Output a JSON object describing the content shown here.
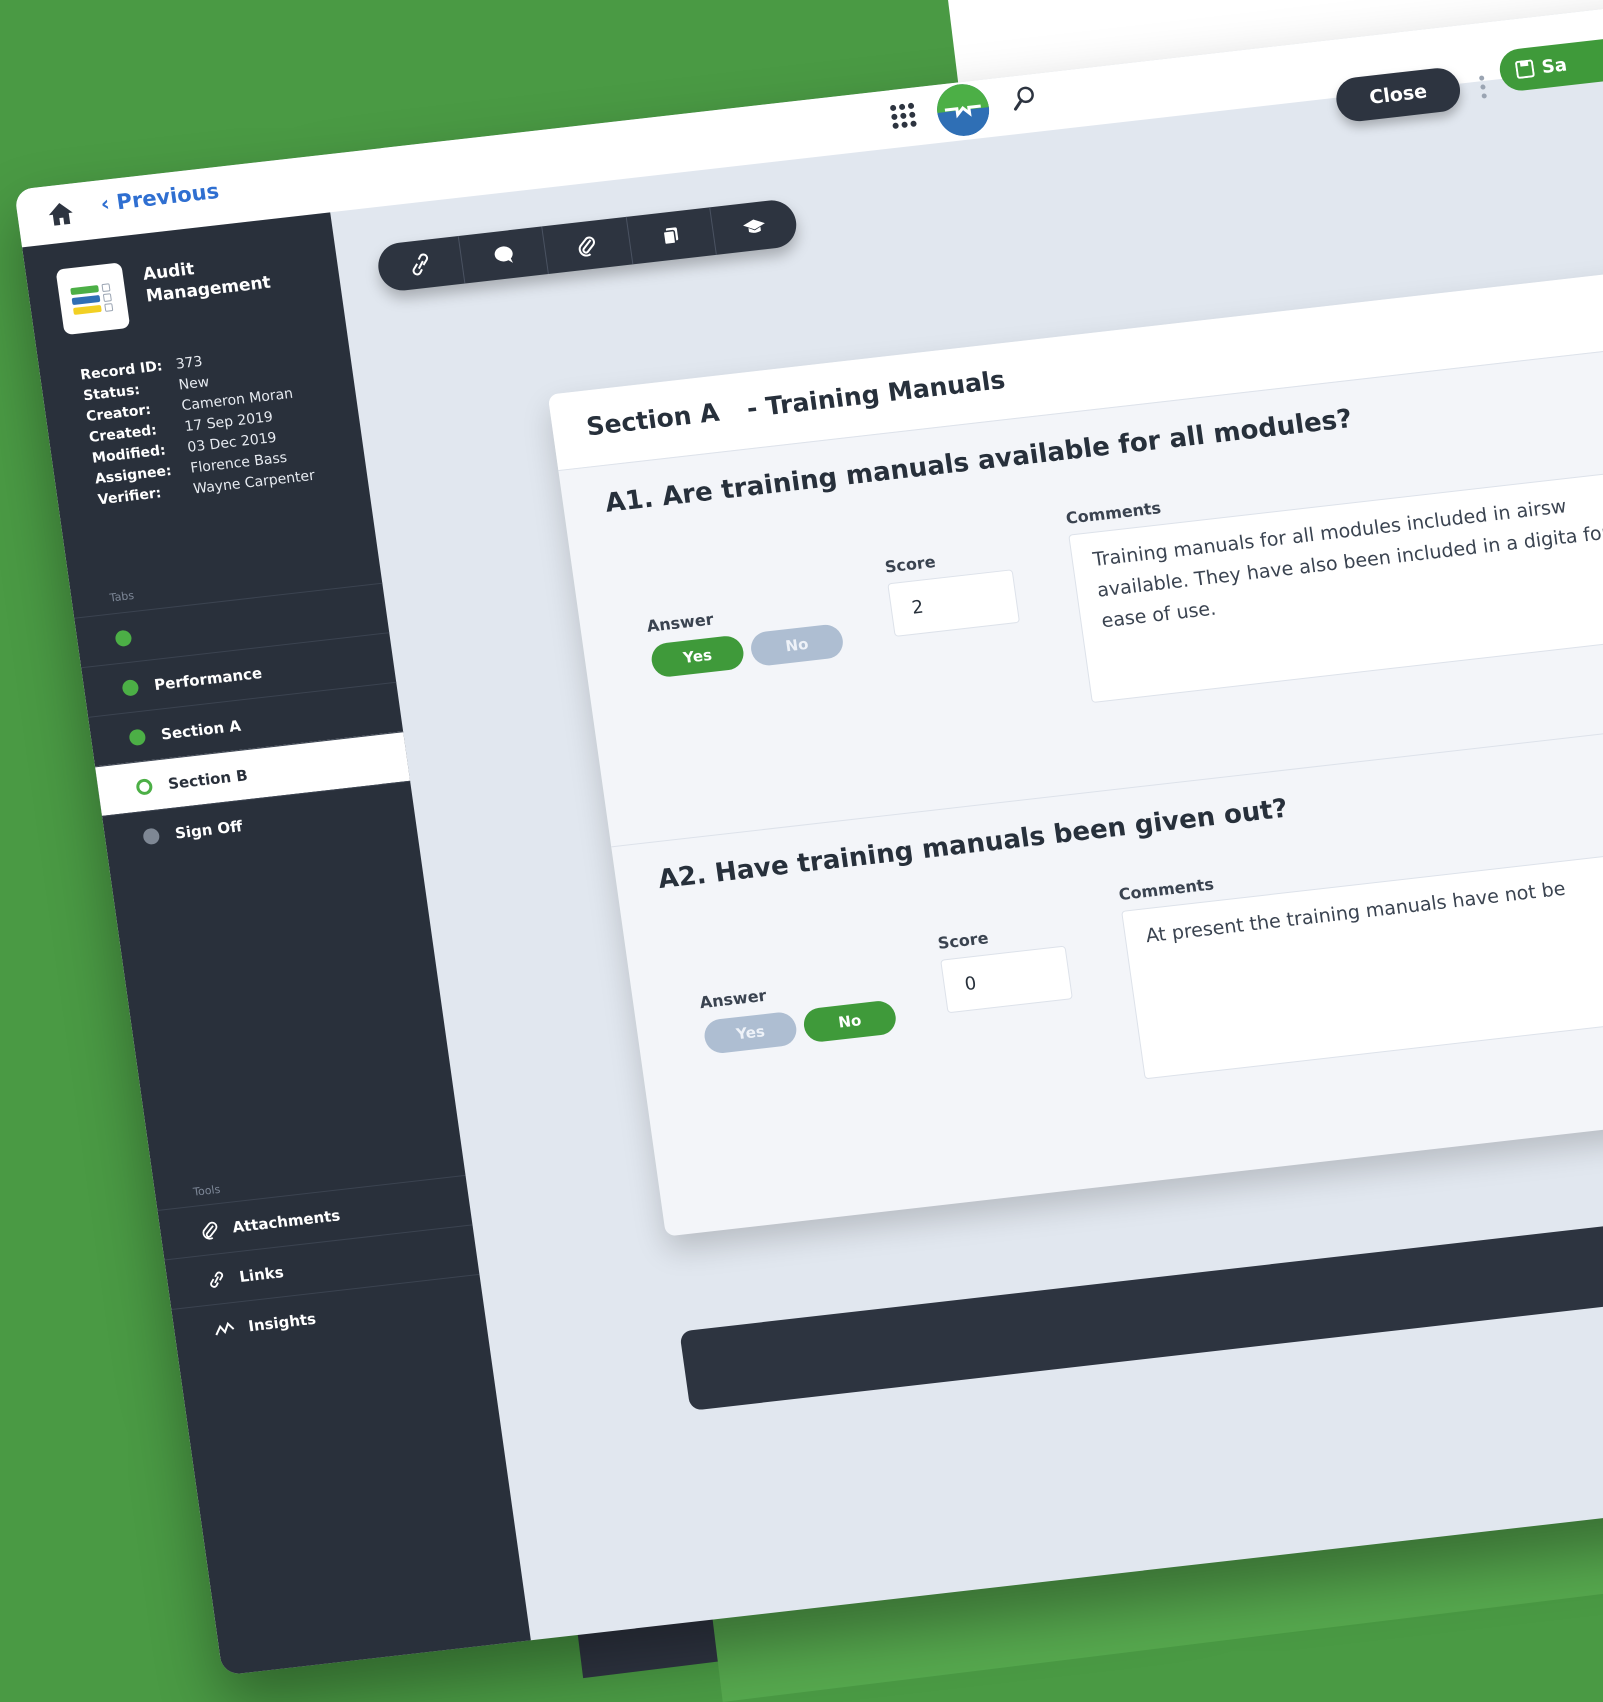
{
  "nav": {
    "previous_label": "Previous"
  },
  "header": {
    "close_label": "Close",
    "save_label": "Sa"
  },
  "sidebar": {
    "app_title_line1": "Audit",
    "app_title_line2": "Management",
    "record": [
      {
        "key": "Record ID:",
        "value": "373"
      },
      {
        "key": "Status:",
        "value": "New"
      },
      {
        "key": "Creator:",
        "value": "Cameron Moran"
      },
      {
        "key": "Created:",
        "value": "17 Sep 2019"
      },
      {
        "key": "Modified:",
        "value": "03 Dec 2019"
      },
      {
        "key": "Assignee:",
        "value": "Florence Bass"
      },
      {
        "key": "Verifier:",
        "value": "Wayne Carpenter"
      }
    ],
    "tabs_label": "Tabs",
    "tabs": [
      {
        "label": "",
        "status": "complete"
      },
      {
        "label": "Performance",
        "status": "complete"
      },
      {
        "label": "Section A",
        "status": "complete"
      },
      {
        "label": "Section B",
        "status": "active"
      },
      {
        "label": "Sign Off",
        "status": "pending"
      }
    ],
    "tools_label": "Tools",
    "tools": [
      {
        "label": "Attachments",
        "icon": "paperclip-icon"
      },
      {
        "label": "Links",
        "icon": "link-icon"
      },
      {
        "label": "Insights",
        "icon": "insights-icon"
      }
    ]
  },
  "toolbar": {
    "icons": [
      "link-icon",
      "comment-icon",
      "paperclip-icon",
      "copy-icon",
      "graduation-cap-icon"
    ]
  },
  "section": {
    "name": "Section A",
    "subtitle": "- Training Manuals"
  },
  "questions": [
    {
      "title": "A1. Are training manuals available for all modules?",
      "answer_label": "Answer",
      "yes_label": "Yes",
      "no_label": "No",
      "selected": "Yes",
      "score_label": "Score",
      "score": "2",
      "comments_label": "Comments",
      "comment": "Training manuals for all modules included in airsw available. They have also been included in a digita for ease of use."
    },
    {
      "title": "A2. Have training manuals been given out?",
      "answer_label": "Answer",
      "yes_label": "Yes",
      "no_label": "No",
      "selected": "No",
      "score_label": "Score",
      "score": "0",
      "comments_label": "Comments",
      "comment": "At present the training manuals have not be"
    }
  ],
  "colors": {
    "brand_green": "#3f9a3a",
    "sidebar_dark": "#29303b",
    "link_blue": "#2f6fd1",
    "pill_inactive": "#aebed2"
  }
}
